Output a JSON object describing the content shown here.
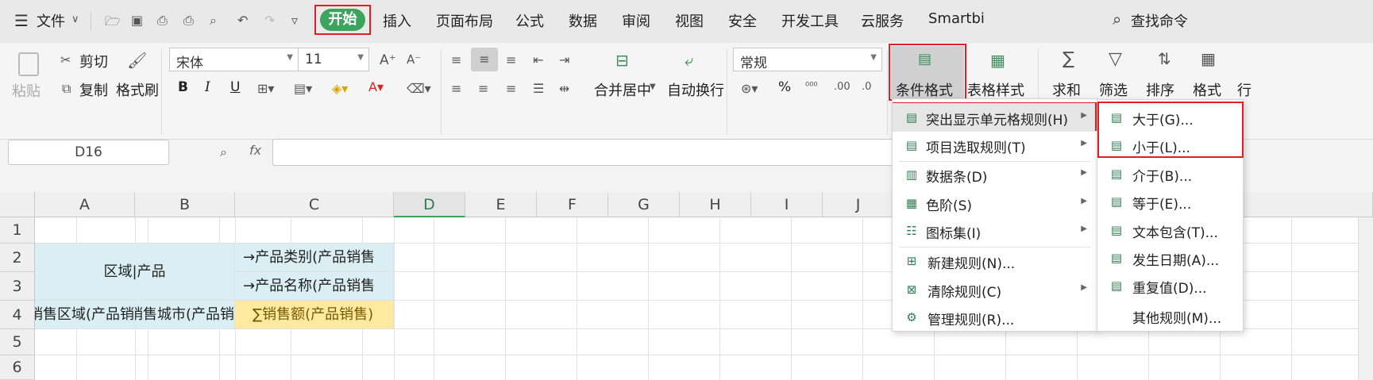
{
  "menubar": {
    "file_label": "文件",
    "tabs": [
      "开始",
      "插入",
      "页面布局",
      "公式",
      "数据",
      "审阅",
      "视图",
      "安全",
      "开发工具",
      "云服务",
      "Smartbi"
    ],
    "search_label": "查找命令"
  },
  "ribbon": {
    "paste": "粘贴",
    "cut": "剪切",
    "copy": "复制",
    "format_painter": "格式刷",
    "font_name": "宋体",
    "font_size": "11",
    "bold": "B",
    "italic": "I",
    "underline": "U",
    "merge_center": "合并居中",
    "wrap_text": "自动换行",
    "number_format": "常规",
    "percent": "%",
    "cond_format": "条件格式",
    "table_style": "表格样式",
    "sum": "求和",
    "filter": "筛选",
    "sort": "排序",
    "format": "格式",
    "row_col": "行"
  },
  "formula_bar": {
    "name_box": "D16",
    "fx": "fx",
    "value": ""
  },
  "sheet": {
    "columns": [
      "A",
      "B",
      "C",
      "D",
      "E",
      "F",
      "G",
      "H",
      "I",
      "J"
    ],
    "rows": [
      "1",
      "2",
      "3",
      "4",
      "5",
      "6"
    ],
    "cells": {
      "ab23": "区域|产品",
      "c2": "→产品类别(产品销售",
      "c3": "→产品名称(产品销售",
      "a4": "销售区域(产品销",
      "b4": "销售城市(产品销",
      "c4": "∑销售额(产品销售)"
    }
  },
  "cond_menu": {
    "items": [
      "突出显示单元格规则(H)",
      "项目选取规则(T)",
      "数据条(D)",
      "色阶(S)",
      "图标集(I)",
      "新建规则(N)...",
      "清除规则(C)",
      "管理规则(R)..."
    ]
  },
  "sub_menu": {
    "items": [
      "大于(G)...",
      "小于(L)...",
      "介于(B)...",
      "等于(E)...",
      "文本包含(T)...",
      "发生日期(A)...",
      "重复值(D)...",
      "其他规则(M)..."
    ]
  },
  "colors": {
    "accent_green": "#3ca45c",
    "highlight_red": "#e02020",
    "header_fill": "#daeef3",
    "value_fill": "#fde9a0"
  }
}
